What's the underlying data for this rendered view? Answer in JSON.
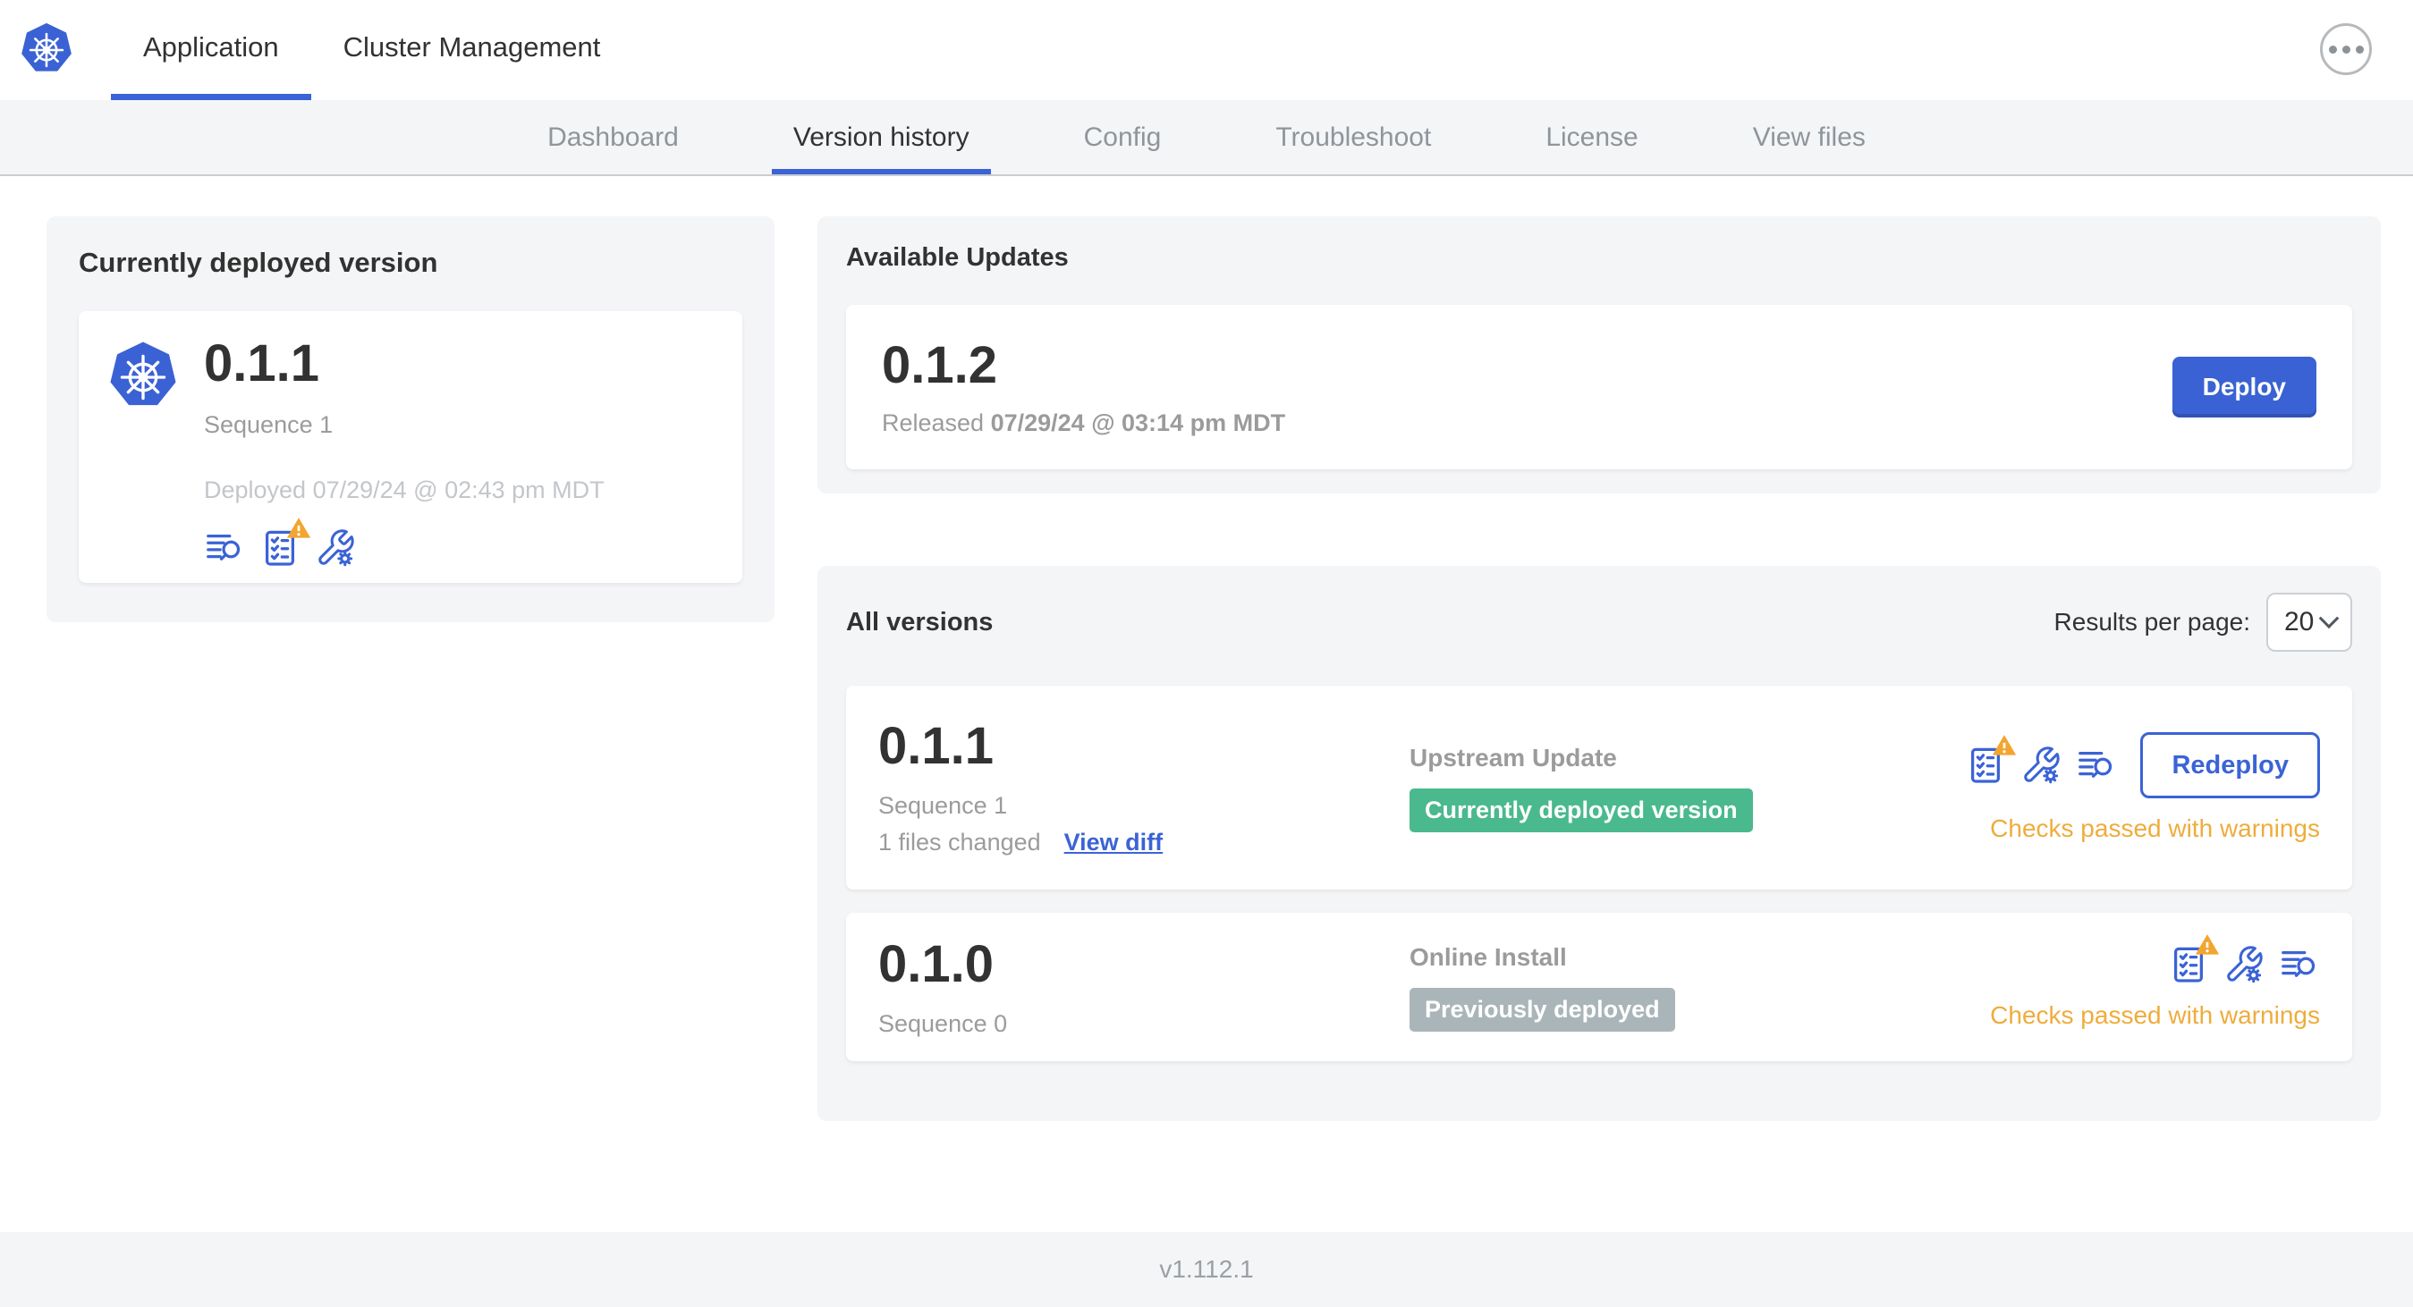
{
  "header": {
    "tabs": [
      {
        "label": "Application",
        "active": true
      },
      {
        "label": "Cluster Management",
        "active": false
      }
    ]
  },
  "subnav": {
    "tabs": [
      {
        "label": "Dashboard",
        "active": false
      },
      {
        "label": "Version history",
        "active": true
      },
      {
        "label": "Config",
        "active": false
      },
      {
        "label": "Troubleshoot",
        "active": false
      },
      {
        "label": "License",
        "active": false
      },
      {
        "label": "View files",
        "active": false
      }
    ]
  },
  "current_version": {
    "title": "Currently deployed version",
    "version": "0.1.1",
    "sequence": "Sequence 1",
    "deployed": "Deployed 07/29/24 @ 02:43 pm MDT",
    "icons": [
      "deploy-logs-icon",
      "preflight-checks-warning-icon",
      "edit-config-icon"
    ]
  },
  "available_updates": {
    "title": "Available Updates",
    "version": "0.1.2",
    "released_prefix": "Released",
    "released_date": "07/29/24 @ 03:14 pm MDT",
    "deploy_label": "Deploy"
  },
  "all_versions": {
    "title": "All versions",
    "results_per_page_label": "Results per page:",
    "results_per_page_value": "20",
    "rows": [
      {
        "version": "0.1.1",
        "sequence": "Sequence 1",
        "files_changed": "1 files changed",
        "view_diff_label": "View diff",
        "source": "Upstream Update",
        "badge": "Currently deployed version",
        "badge_color": "#4ab98d",
        "action_label": "Redeploy",
        "status": "Checks passed with warnings",
        "icons": [
          "preflight-checks-warning-icon",
          "edit-config-icon",
          "deploy-logs-icon"
        ]
      },
      {
        "version": "0.1.0",
        "sequence": "Sequence 0",
        "source": "Online Install",
        "badge": "Previously deployed",
        "badge_color": "#aab5b9",
        "status": "Checks passed with warnings",
        "icons": [
          "preflight-checks-warning-icon",
          "edit-config-icon",
          "deploy-logs-icon"
        ]
      }
    ]
  },
  "footer": {
    "app_version": "v1.112.1"
  },
  "icons": {
    "header_logo": "kubernetes-logo",
    "overflow_menu": "ellipsis-icon",
    "select_caret": "chevron-down-icon",
    "warning_overlay": "warning-triangle-icon"
  },
  "colors": {
    "accent_blue": "#3b63d6",
    "k8s_blue": "#3a62d4",
    "success_green": "#4ab98d",
    "muted_badge_gray": "#aab5b9",
    "warning_orange": "#efac3c",
    "card_gray": "#f4f5f7",
    "text_dark": "#323232",
    "text_gray": "#9b9b9b",
    "text_light_gray": "#c3c6ca"
  }
}
